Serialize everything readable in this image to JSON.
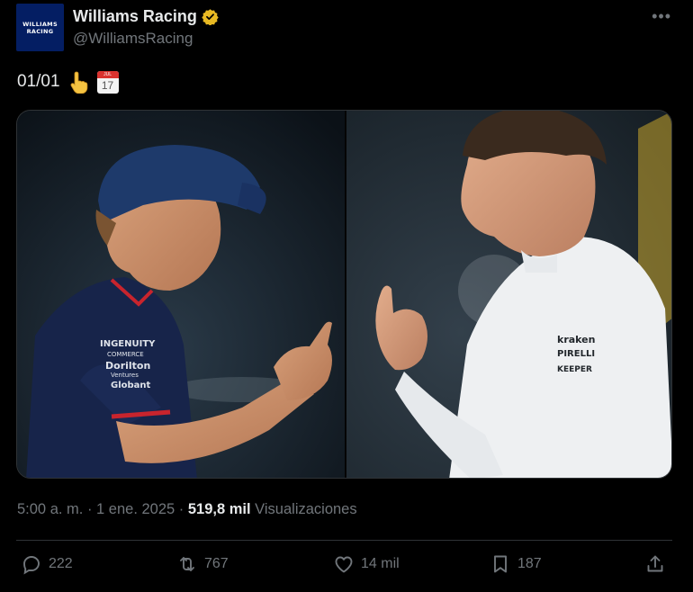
{
  "tweet": {
    "avatar_text_line1": "WILLIAMS",
    "avatar_text_line2": "RACING",
    "author_name": "Williams Racing",
    "author_handle": "@WilliamsRacing",
    "more_icon": "more-horizontal-icon",
    "text": "01/01",
    "emojis": [
      "backhand-index-pointing-up-emoji",
      "calendar-emoji"
    ],
    "calendar_emoji_month": "JUL",
    "calendar_emoji_day": "17",
    "timestamp": "5:00 a. m. · 1 ene. 2025 · ",
    "views_count": "519,8 mil",
    "views_label": " Visualizaciones"
  },
  "media": {
    "description_left": "driver-pointing-finger",
    "description_right": "team-principal-pointing-finger",
    "left_sponsors": [
      "INGENUITY",
      "COMMERCE",
      "Dorilton",
      "Ventures",
      "Globant"
    ],
    "right_sponsors": [
      "kraken",
      "PIRELLI",
      "KEEPER"
    ]
  },
  "actions": {
    "replies": "222",
    "reposts": "767",
    "likes": "14 mil",
    "bookmarks": "187"
  },
  "colors": {
    "background": "#000000",
    "text_primary": "#e7e9ea",
    "text_secondary": "#71767b",
    "verified": "#e8b923",
    "divider": "#2f3336"
  }
}
